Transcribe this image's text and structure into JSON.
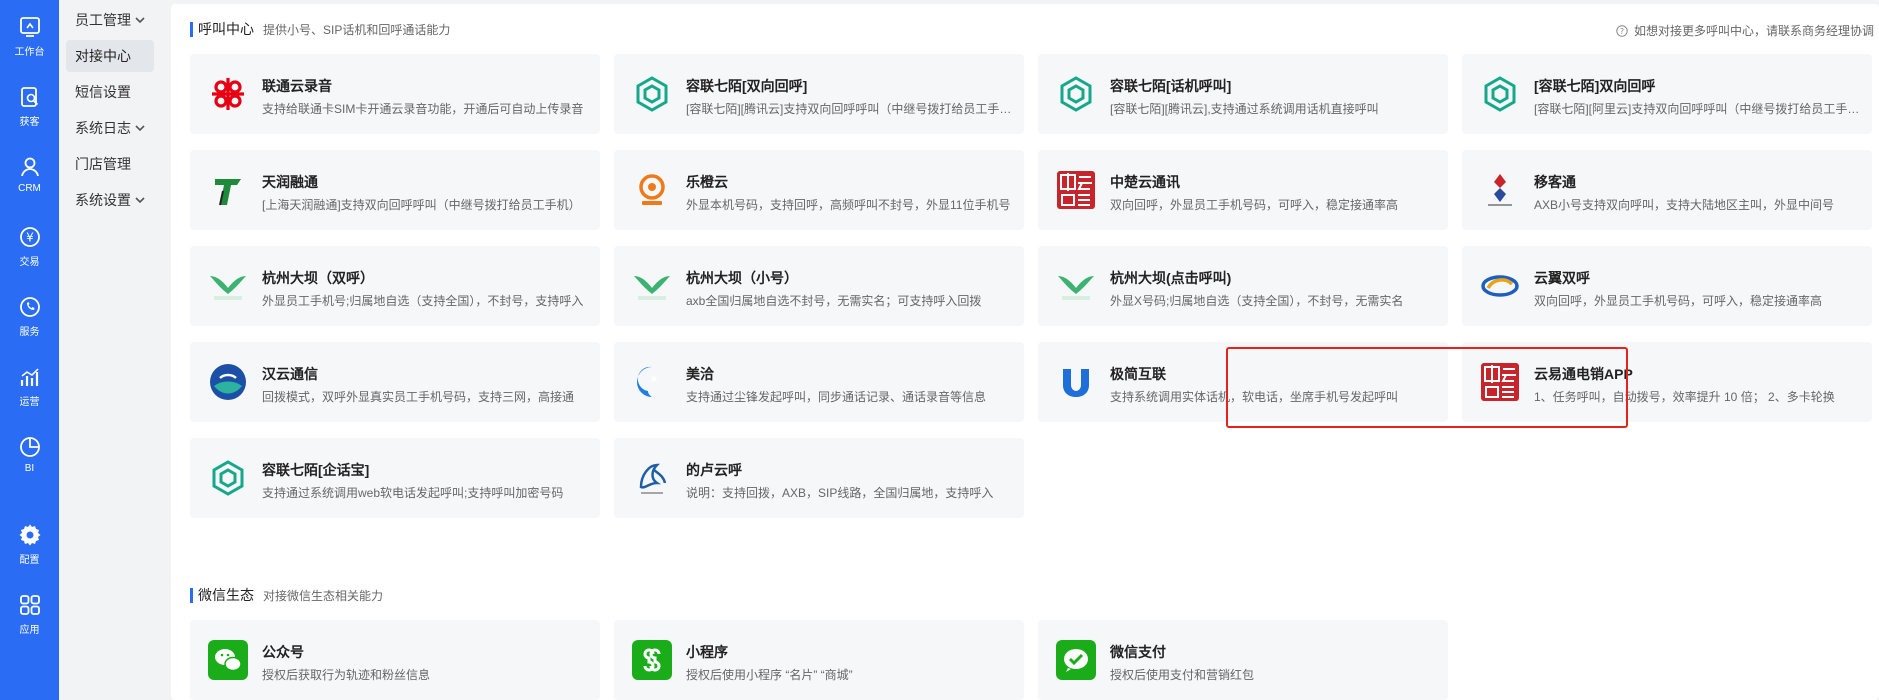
{
  "rail": {
    "items": [
      {
        "label": "工作台",
        "icon": "dashboard-icon"
      },
      {
        "label": "获客",
        "icon": "search-doc-icon"
      },
      {
        "label": "CRM",
        "icon": "person-icon"
      },
      {
        "label": "交易",
        "icon": "yuan-icon"
      },
      {
        "label": "服务",
        "icon": "phone-icon"
      },
      {
        "label": "运营",
        "icon": "bar-chart-icon"
      },
      {
        "label": "BI",
        "icon": "pie-chart-icon"
      },
      {
        "label": "配置",
        "icon": "gear-icon"
      },
      {
        "label": "应用",
        "icon": "grid-icon"
      }
    ]
  },
  "submenu": {
    "items": [
      {
        "label": "员工管理",
        "has_chevron": true
      },
      {
        "label": "对接中心",
        "active": true
      },
      {
        "label": "短信设置"
      },
      {
        "label": "系统日志",
        "has_chevron": true
      },
      {
        "label": "门店管理"
      },
      {
        "label": "系统设置",
        "has_chevron": true
      }
    ]
  },
  "call_center": {
    "title": "呼叫中心",
    "subtitle": "提供小号、SIP话机和回呼通话能力",
    "help_text": "如想对接更多呼叫中心，请联系商务经理协调",
    "cards": [
      {
        "name": "联通云录音",
        "desc": "支持给联通卡SIM卡开通云录音功能，开通后可自动上传录音"
      },
      {
        "name": "容联七陌[双向回呼]",
        "desc": "[容联七陌][腾讯云]支持双向回呼呼叫（中继号拨打给员工手机）"
      },
      {
        "name": "容联七陌[话机呼叫]",
        "desc": "[容联七陌][腾讯云],支持通过系统调用话机直接呼叫"
      },
      {
        "name": "[容联七陌]双向回呼",
        "desc": "[容联七陌][阿里云]支持双向回呼呼叫（中继号拨打给员工手机）"
      },
      {
        "name": "天润融通",
        "desc": "[上海天润融通]支持双向回呼呼叫（中继号拨打给员工手机）"
      },
      {
        "name": "乐橙云",
        "desc": "外显本机号码，支持回呼，高频呼叫不封号，外显11位手机号"
      },
      {
        "name": "中楚云通讯",
        "desc": "双向回呼，外显员工手机号码，可呼入，稳定接通率高"
      },
      {
        "name": "移客通",
        "desc": "AXB小号支持双向呼叫，支持大陆地区主叫，外显中间号"
      },
      {
        "name": "杭州大坝（双呼）",
        "desc": "外显员工手机号;归属地自选（支持全国），不封号，支持呼入"
      },
      {
        "name": "杭州大坝（小号）",
        "desc": "axb全国归属地自选不封号，无需实名；可支持呼入回拨"
      },
      {
        "name": "杭州大坝(点击呼叫)",
        "desc": "外显X号码;归属地自选（支持全国），不封号，无需实名"
      },
      {
        "name": "云翼双呼",
        "desc": "双向回呼，外显员工手机号码，可呼入，稳定接通率高"
      },
      {
        "name": "汉云通信",
        "desc": "回拨模式，双呼外显真实员工手机号码，支持三网，高接通"
      },
      {
        "name": "美洽",
        "desc": "支持通过尘锋发起呼叫，同步通话记录、通话录音等信息"
      },
      {
        "name": "极简互联",
        "desc": "支持系统调用实体话机，软电话，坐席手机号发起呼叫"
      },
      {
        "name": "云易通电销APP",
        "desc": "1、任务呼叫，自动拨号，效率提升 10 倍； 2、多卡轮换"
      },
      {
        "name": "容联七陌[企话宝]",
        "desc": "支持通过系统调用web软电话发起呼叫;支持呼叫加密号码"
      },
      {
        "name": "的卢云呼",
        "desc": "说明：支持回拨，AXB，SIP线路，全国归属地，支持呼入"
      }
    ]
  },
  "wechat": {
    "title": "微信生态",
    "subtitle": "对接微信生态相关能力",
    "cards": [
      {
        "name": "公众号",
        "desc": "授权后获取行为轨迹和粉丝信息"
      },
      {
        "name": "小程序",
        "desc": "授权后使用小程序 “名片” “商城”"
      },
      {
        "name": "微信支付",
        "desc": "授权后使用支付和营销红包"
      }
    ]
  },
  "colors": {
    "rail": "#2a6df4",
    "accent": "#2a6df4",
    "highlight": "#e5231d",
    "wechat_green": "#1aad19"
  }
}
